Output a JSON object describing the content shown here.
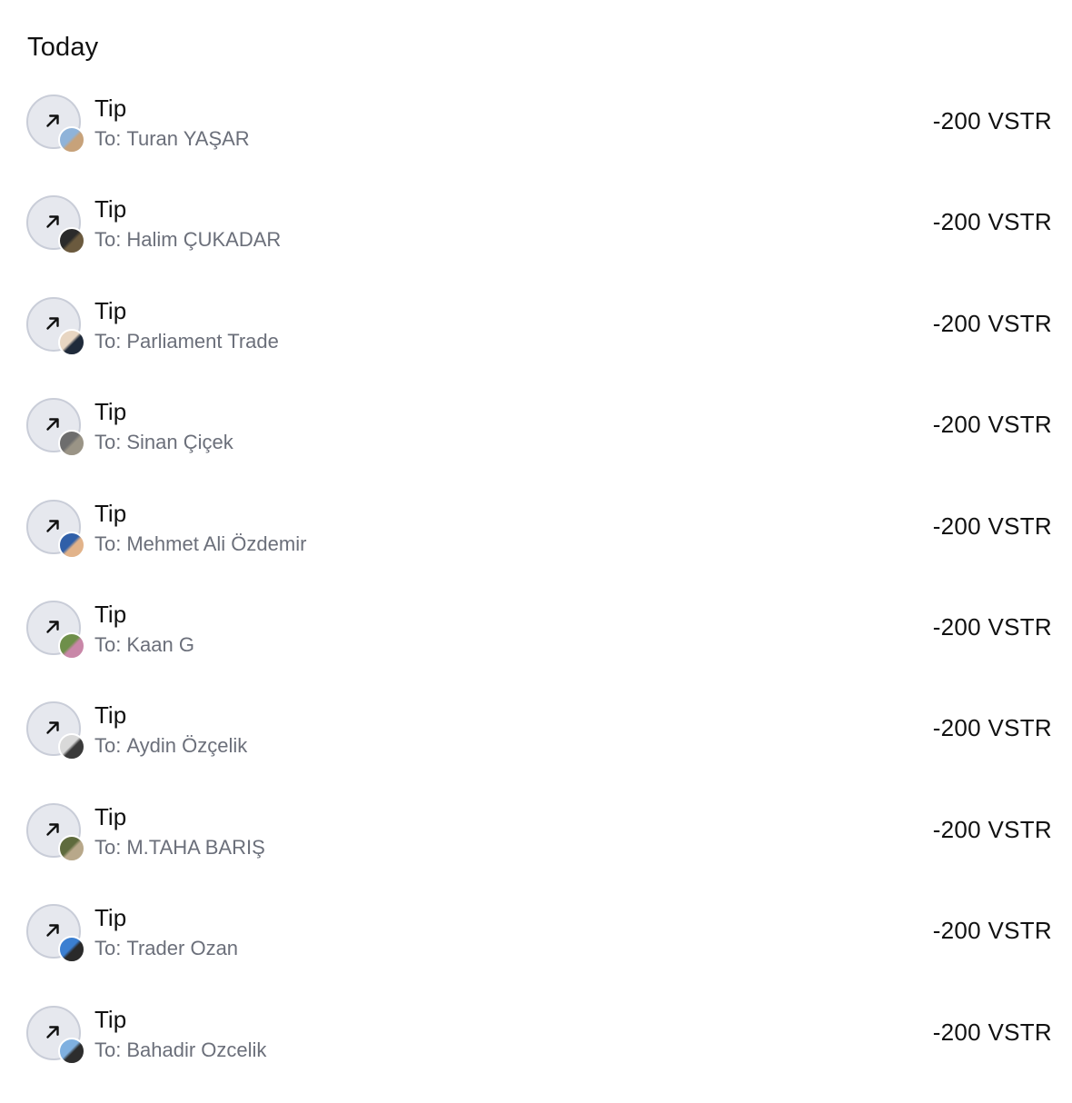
{
  "section_title": "Today",
  "colors": {
    "icon_circle_bg": "#e6e8ee",
    "icon_circle_border": "#c9cdd8",
    "subtitle_text": "#6b6f7a",
    "primary_text": "#111111"
  },
  "transactions": [
    {
      "title": "Tip",
      "to_label": "To:",
      "recipient": "Turan YAŞAR",
      "amount": "-200 VSTR",
      "direction_icon": "arrow-up-right-icon",
      "avatar_colors": [
        "#8fb3d9",
        "#c7a27a"
      ]
    },
    {
      "title": "Tip",
      "to_label": "To:",
      "recipient": "Halim ÇUKADAR",
      "amount": "-200 VSTR",
      "direction_icon": "arrow-up-right-icon",
      "avatar_colors": [
        "#2b2b2b",
        "#6b5a3e"
      ]
    },
    {
      "title": "Tip",
      "to_label": "To:",
      "recipient": "Parliament Trade",
      "amount": "-200 VSTR",
      "direction_icon": "arrow-up-right-icon",
      "avatar_colors": [
        "#e8d6c2",
        "#1f2a3a"
      ]
    },
    {
      "title": "Tip",
      "to_label": "To:",
      "recipient": "Sinan Çiçek",
      "amount": "-200 VSTR",
      "direction_icon": "arrow-up-right-icon",
      "avatar_colors": [
        "#6d6d6d",
        "#9a9486"
      ]
    },
    {
      "title": "Tip",
      "to_label": "To:",
      "recipient": "Mehmet Ali Özdemir",
      "amount": "-200 VSTR",
      "direction_icon": "arrow-up-right-icon",
      "avatar_colors": [
        "#2f5fa8",
        "#e2b38a"
      ]
    },
    {
      "title": "Tip",
      "to_label": "To:",
      "recipient": "Kaan G",
      "amount": "-200 VSTR",
      "direction_icon": "arrow-up-right-icon",
      "avatar_colors": [
        "#6e8f4a",
        "#c987a8"
      ]
    },
    {
      "title": "Tip",
      "to_label": "To:",
      "recipient": "Aydin Özçelik",
      "amount": "-200 VSTR",
      "direction_icon": "arrow-up-right-icon",
      "avatar_colors": [
        "#d9d9d9",
        "#3a3a3a"
      ]
    },
    {
      "title": "Tip",
      "to_label": "To:",
      "recipient": "M.TAHA BARIŞ",
      "amount": "-200 VSTR",
      "direction_icon": "arrow-up-right-icon",
      "avatar_colors": [
        "#5f6b3d",
        "#b8a88a"
      ]
    },
    {
      "title": "Tip",
      "to_label": "To:",
      "recipient": "Trader Ozan",
      "amount": "-200 VSTR",
      "direction_icon": "arrow-up-right-icon",
      "avatar_colors": [
        "#3b7fd1",
        "#2a2a2a"
      ]
    },
    {
      "title": "Tip",
      "to_label": "To:",
      "recipient": "Bahadir Ozcelik",
      "amount": "-200 VSTR",
      "direction_icon": "arrow-up-right-icon",
      "avatar_colors": [
        "#7fb0e0",
        "#2d2d2d"
      ]
    }
  ]
}
